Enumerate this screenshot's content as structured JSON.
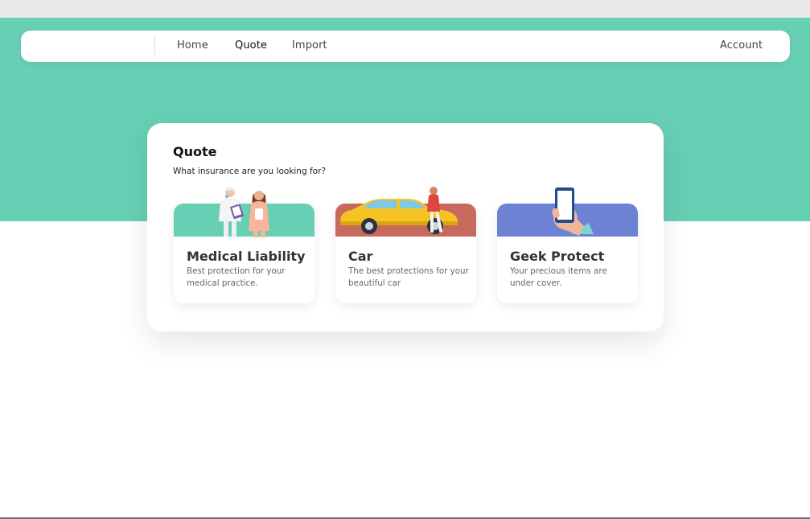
{
  "colors": {
    "hero": "#66cfb4",
    "medical_banner": "#66cfb4",
    "car_banner": "#c76a5d",
    "geek_banner": "#6d82d2",
    "car_body": "#f6c324"
  },
  "nav": {
    "home": "Home",
    "quote": "Quote",
    "import": "Import",
    "account": "Account",
    "active": "Quote"
  },
  "quote": {
    "title": "Quote",
    "subtitle": "What insurance are you looking for?",
    "cards": [
      {
        "title": "Medical Liability",
        "desc": "Best protection for your medical practice.",
        "illustration": "doctor-nurse-icon"
      },
      {
        "title": "Car",
        "desc": "The best protections for your beautiful car",
        "illustration": "car-icon"
      },
      {
        "title": "Geek Protect",
        "desc": "Your precious items are under cover.",
        "illustration": "phone-hand-icon"
      }
    ]
  }
}
